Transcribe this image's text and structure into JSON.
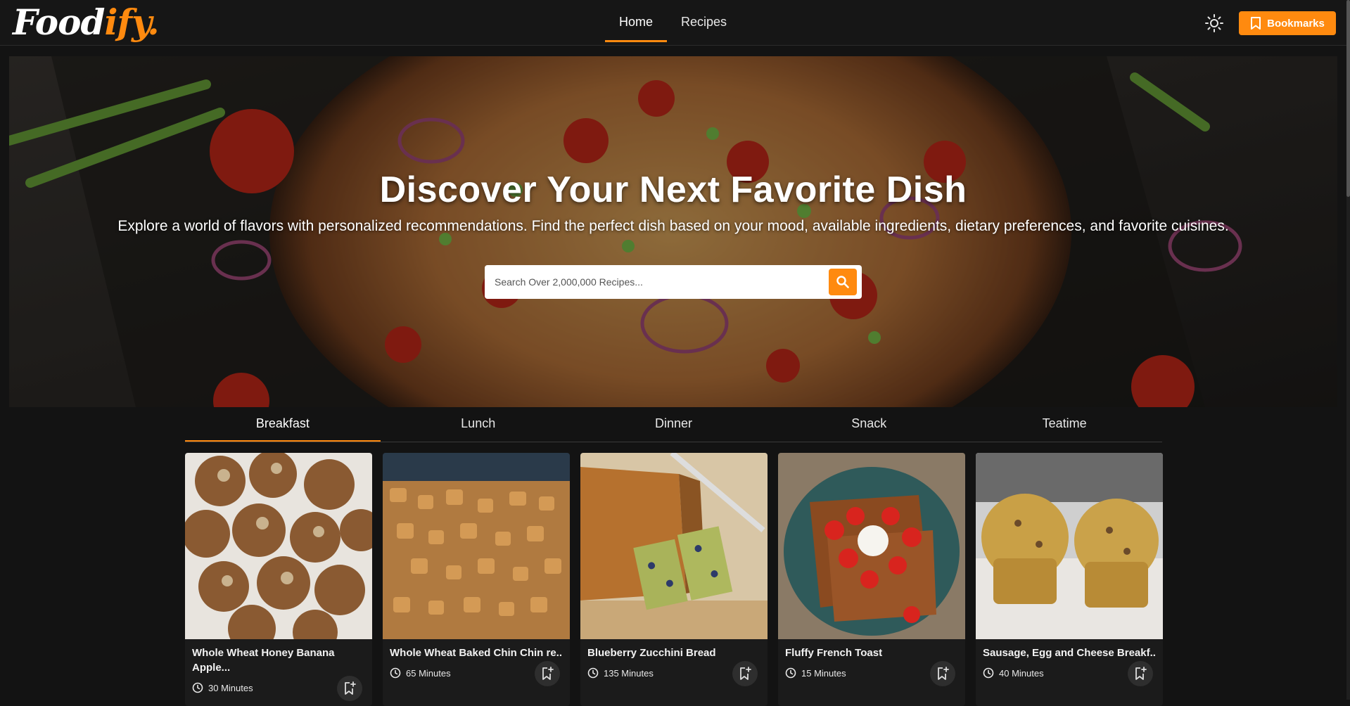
{
  "app": {
    "logo_part1": "Food",
    "logo_part2": "ify."
  },
  "nav": {
    "items": [
      {
        "label": "Home",
        "active": true
      },
      {
        "label": "Recipes",
        "active": false
      }
    ]
  },
  "header": {
    "theme_icon": "sun-icon",
    "bookmarks_label": "Bookmarks"
  },
  "hero": {
    "title": "Discover Your Next Favorite Dish",
    "subtitle": "Explore a world of flavors with personalized recommendations. Find the perfect dish based on your mood, available ingredients, dietary preferences, and favorite cuisines.",
    "search_placeholder": "Search Over 2,000,000 Recipes..."
  },
  "tabs": [
    {
      "label": "Breakfast",
      "active": true
    },
    {
      "label": "Lunch",
      "active": false
    },
    {
      "label": "Dinner",
      "active": false
    },
    {
      "label": "Snack",
      "active": false
    },
    {
      "label": "Teatime",
      "active": false
    }
  ],
  "recipes": [
    {
      "title": "Whole Wheat Honey Banana Apple...",
      "time": "30 Minutes"
    },
    {
      "title": "Whole Wheat Baked Chin Chin re...",
      "time": "65 Minutes"
    },
    {
      "title": "Blueberry Zucchini Bread",
      "time": "135 Minutes"
    },
    {
      "title": "Fluffy French Toast",
      "time": "15 Minutes"
    },
    {
      "title": "Sausage, Egg and Cheese Breakf...",
      "time": "40 Minutes"
    }
  ],
  "colors": {
    "accent": "#ff8a0f",
    "background": "#131313"
  }
}
